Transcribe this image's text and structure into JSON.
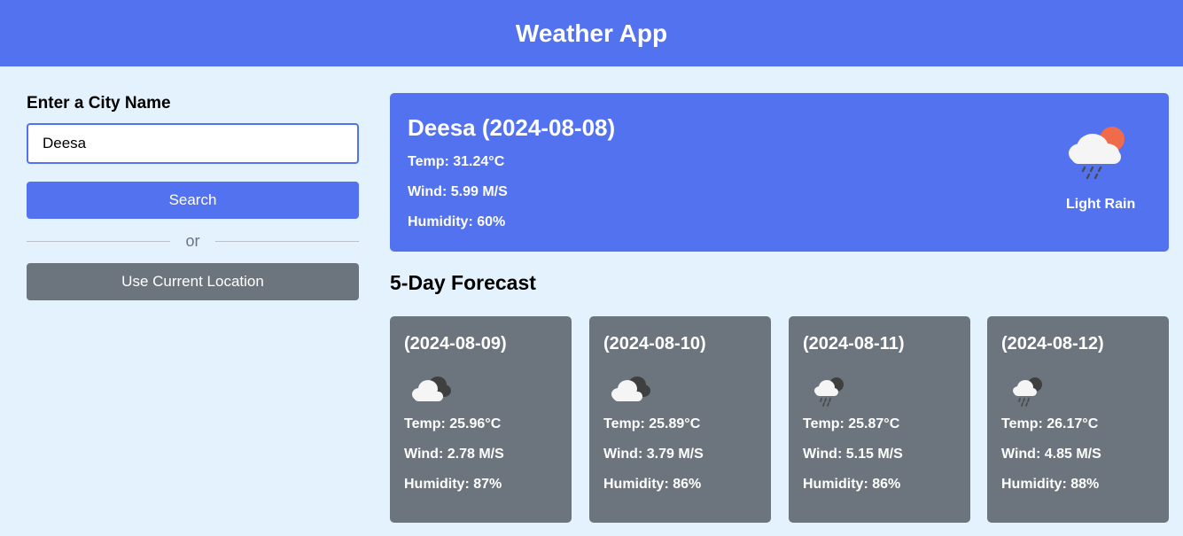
{
  "header": {
    "title": "Weather App"
  },
  "search": {
    "label": "Enter a City Name",
    "value": "Deesa",
    "search_button": "Search",
    "separator": "or",
    "location_button": "Use Current Location"
  },
  "current": {
    "heading": "Deesa (2024-08-08)",
    "temp": "Temp: 31.24°C",
    "wind": "Wind: 5.99 M/S",
    "humidity": "Humidity: 60%",
    "condition": "Light Rain",
    "icon": "cloud-rain-sun-icon"
  },
  "forecast": {
    "title": "5-Day Forecast",
    "days": [
      {
        "date": "(2024-08-09)",
        "temp": "Temp: 25.96°C",
        "wind": "Wind: 2.78 M/S",
        "humidity": "Humidity: 87%",
        "icon": "cloud-icon"
      },
      {
        "date": "(2024-08-10)",
        "temp": "Temp: 25.89°C",
        "wind": "Wind: 3.79 M/S",
        "humidity": "Humidity: 86%",
        "icon": "cloud-icon"
      },
      {
        "date": "(2024-08-11)",
        "temp": "Temp: 25.87°C",
        "wind": "Wind: 5.15 M/S",
        "humidity": "Humidity: 86%",
        "icon": "cloud-rain-icon"
      },
      {
        "date": "(2024-08-12)",
        "temp": "Temp: 26.17°C",
        "wind": "Wind: 4.85 M/S",
        "humidity": "Humidity: 88%",
        "icon": "cloud-rain-icon"
      }
    ]
  },
  "colors": {
    "primary": "#5372f0",
    "secondary": "#6c757d",
    "background": "#e3f2fd"
  }
}
